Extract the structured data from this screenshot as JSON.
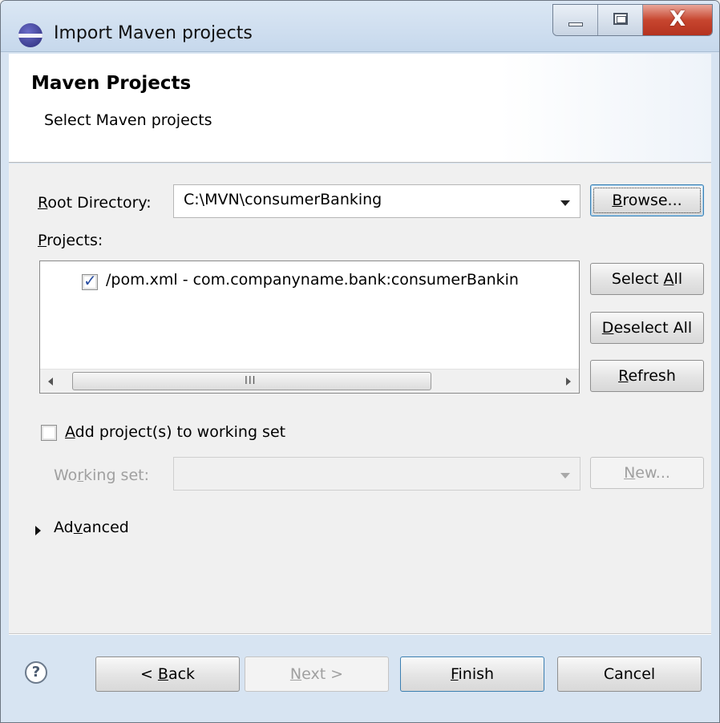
{
  "window": {
    "title": "Import Maven projects",
    "close_glyph": "X"
  },
  "header": {
    "title": "Maven Projects",
    "subtitle": "Select Maven projects"
  },
  "root_directory": {
    "label_mnemonic": "R",
    "label_rest": "oot Directory:",
    "value": "C:\\MVN\\consumerBanking",
    "browse_mnemonic": "B",
    "browse_rest": "rowse..."
  },
  "projects": {
    "label_mnemonic": "P",
    "label_rest": "rojects:",
    "items": [
      {
        "text": "/pom.xml - com.companyname.bank:consumerBankin",
        "checked": true
      }
    ],
    "scroll_grip": "III",
    "select_all_pre": "Select ",
    "select_all_mnemonic": "A",
    "select_all_post": "ll",
    "deselect_all_mnemonic": "D",
    "deselect_all_rest": "eselect All",
    "refresh_mnemonic": "R",
    "refresh_rest": "efresh"
  },
  "working_set": {
    "checkbox_mnemonic": "A",
    "checkbox_rest": "dd project(s) to working set",
    "label_pre": "Wo",
    "label_mnemonic": "r",
    "label_post": "king set:",
    "value": "",
    "new_mnemonic": "N",
    "new_rest": "ew..."
  },
  "advanced": {
    "pre": "Ad",
    "mnemonic": "v",
    "post": "anced"
  },
  "footer": {
    "help_glyph": "?",
    "back_pre": "< ",
    "back_mnemonic": "B",
    "back_post": "ack",
    "next_mnemonic": "N",
    "next_post": "ext >",
    "finish_mnemonic": "F",
    "finish_post": "inish",
    "cancel": "Cancel"
  }
}
